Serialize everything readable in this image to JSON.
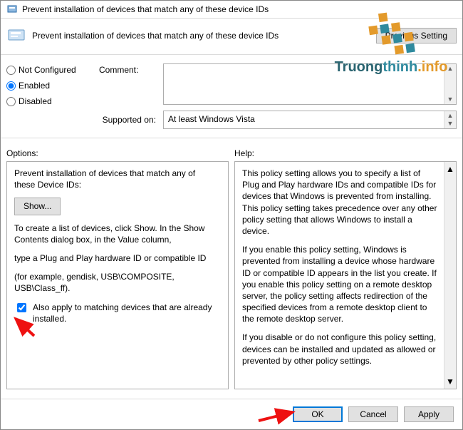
{
  "window": {
    "title": "Prevent installation of devices that match any of these device IDs",
    "subtitle": "Prevent installation of devices that match any of these device IDs"
  },
  "buttons": {
    "previous": "Previous Setting",
    "show": "Show...",
    "ok": "OK",
    "cancel": "Cancel",
    "apply": "Apply"
  },
  "radio": {
    "not_configured": "Not Configured",
    "enabled": "Enabled",
    "disabled": "Disabled",
    "selected": "enabled"
  },
  "labels": {
    "comment": "Comment:",
    "supported_on": "Supported on:",
    "options": "Options:",
    "help": "Help:"
  },
  "supported_on": "At least Windows Vista",
  "options_panel": {
    "heading": "Prevent installation of devices that match any of these Device IDs:",
    "line1": "To create a list of devices, click Show. In the Show Contents dialog box, in the Value column,",
    "line2": "type a Plug and Play hardware ID or compatible ID",
    "line3": "(for example, gendisk, USB\\COMPOSITE, USB\\Class_ff).",
    "checkbox_label": "Also apply to matching devices that are already installed."
  },
  "help_text": {
    "p1": "This policy setting allows you to specify a list of Plug and Play hardware IDs and compatible IDs for devices that Windows is prevented from installing. This policy setting takes precedence over any other policy setting that allows Windows to install a device.",
    "p2": "If you enable this policy setting, Windows is prevented from installing a device whose hardware ID or compatible ID appears in the list you create. If you enable this policy setting on a remote desktop server, the policy setting affects redirection of the specified devices from a remote desktop client to the remote desktop server.",
    "p3": "If you disable or do not configure this policy setting, devices can be installed and updated as allowed or prevented by other policy settings."
  },
  "watermark": {
    "text_a": "Truong",
    "text_b": "thinh",
    "text_c": ".info"
  }
}
